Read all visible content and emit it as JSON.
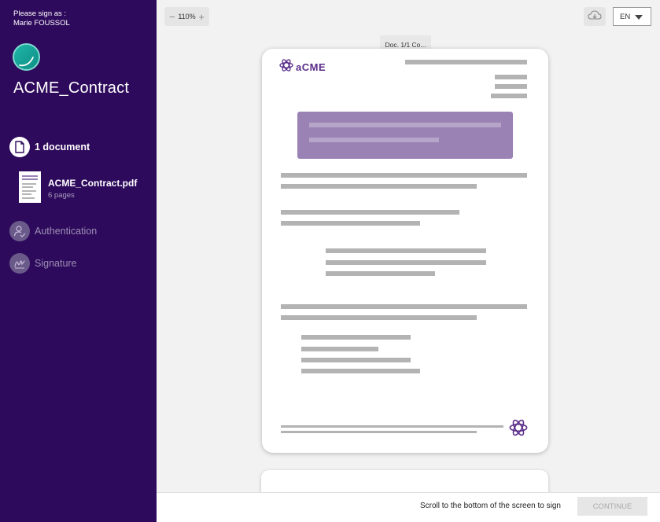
{
  "sidebar": {
    "sign_as_label": "Please sign as :",
    "signer_name": "Marie FOUSSOL",
    "contract_title": "ACME_Contract",
    "steps": [
      {
        "label": "1 document",
        "state": "active",
        "icon": "document-icon"
      },
      {
        "label": "Authentication",
        "state": "inactive",
        "icon": "user-check-icon"
      },
      {
        "label": "Signature",
        "state": "inactive",
        "icon": "signature-icon"
      }
    ],
    "document": {
      "name": "ACME_Contract.pdf",
      "pages": "6 pages"
    }
  },
  "toolbar": {
    "zoom_minus": "−",
    "zoom_level": "110%",
    "zoom_plus": "+",
    "language": "EN",
    "doc_tab": "Doc. 1/1 Co..."
  },
  "document_page": {
    "logo_text": "aCME",
    "brand_color": "#5a2d8a",
    "highlight_color": "#9a82b5"
  },
  "footer": {
    "message": "Scroll to the bottom of the screen to sign",
    "continue_label": "CONTINUE"
  },
  "colors": {
    "sidebar_bg": "#2e0a5c",
    "avatar": "#1fb5a8"
  }
}
